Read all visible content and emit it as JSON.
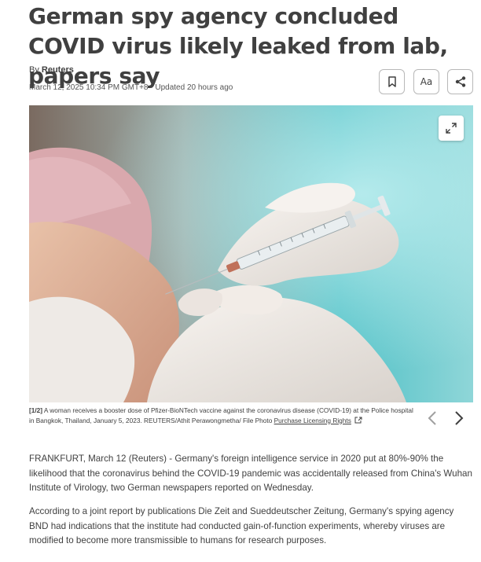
{
  "article": {
    "headline": "German spy agency concluded COVID virus likely leaked from lab, papers say",
    "byline_prefix": "By",
    "author": "Reuters",
    "dateline": "March 12, 2025 10:34 PM GMT+8 · Updated 20 hours ago"
  },
  "toolbar": {
    "bookmark_icon": "bookmark-icon",
    "text_size_label": "Aa",
    "share_icon": "share-icon"
  },
  "gallery": {
    "counter": "[1/2]",
    "caption": " A woman receives a booster dose of Pfizer-BioNTech vaccine against the coronavirus disease (COVID-19) at the Police hospital in Bangkok, Thailand, January 5, 2023. REUTERS/Athit Perawongmetha/ File Photo ",
    "licensing_link": "Purchase Licensing Rights",
    "expand_icon": "expand-icon",
    "prev_icon": "chevron-left-icon",
    "next_icon": "chevron-right-icon"
  },
  "body": {
    "paragraph_1": "FRANKFURT, March 12 (Reuters) - Germany's foreign intelligence service in 2020 put at 80%-90% the likelihood that the coronavirus behind the COVID-19 pandemic was accidentally released from China's Wuhan Institute of Virology, two German newspapers reported on Wednesday.",
    "paragraph_2": "According to a joint report by publications Die Zeit and Sueddeutscher Zeitung, Germany's spying agency BND had indications that the institute had conducted gain-of-function experiments, whereby viruses are modified to become more transmissible to humans for research purposes."
  },
  "colors": {
    "text": "#404040",
    "background": "#ffffff",
    "photo_teal": "#5fc7cc",
    "border": "#b8b8b8"
  }
}
